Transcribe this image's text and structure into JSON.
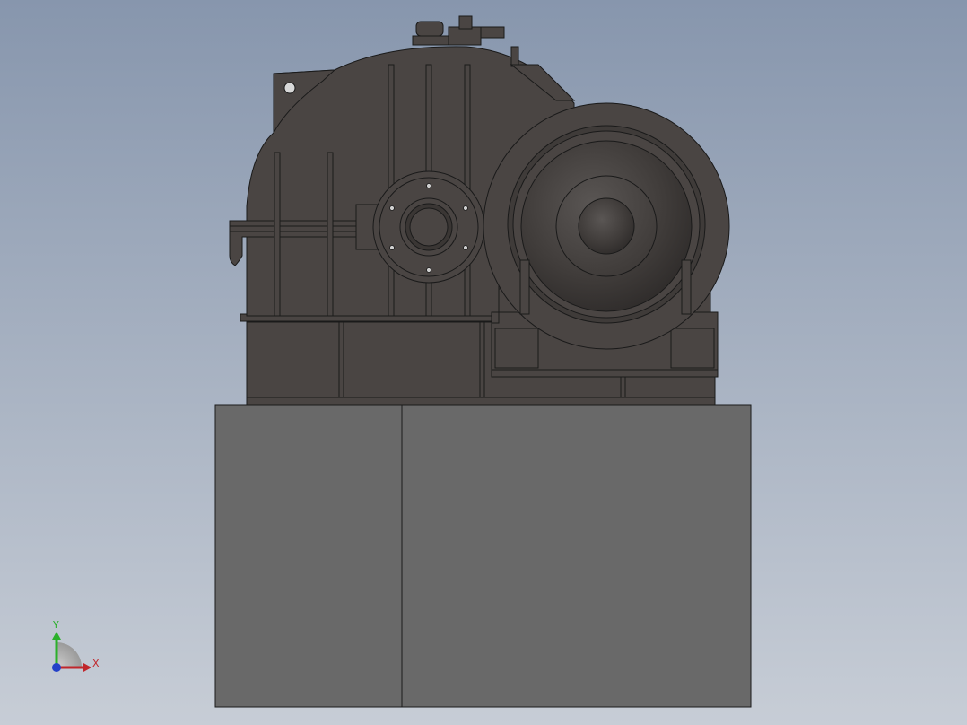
{
  "view": {
    "background_top": "#8796ad",
    "background_bottom": "#c7cdd6"
  },
  "model": {
    "housing_color": "#4a4543",
    "edge_color": "#1a1a1a",
    "motor_color": "#3f3b39",
    "base_color": "#696969"
  },
  "triad": {
    "x_label": "X",
    "y_label": "Y",
    "x_color": "#c0262b",
    "y_color": "#2bb02b",
    "z_color": "#2340c8"
  }
}
